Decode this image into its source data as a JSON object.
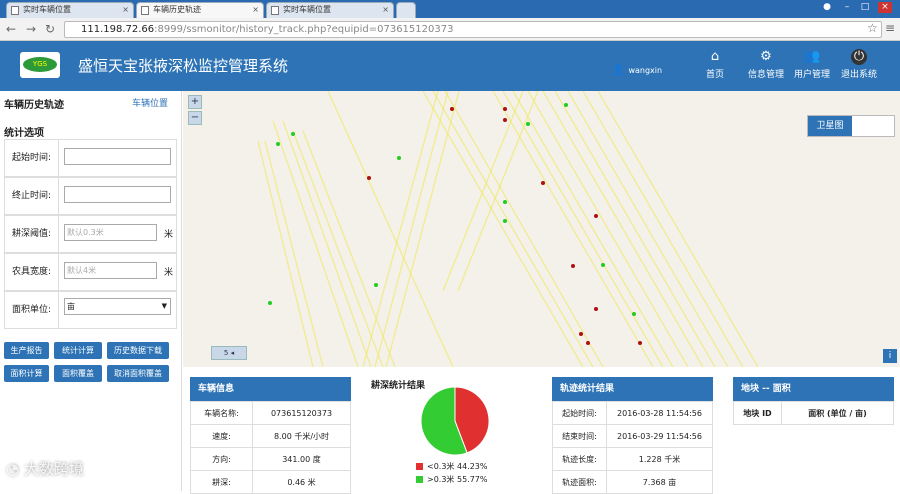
{
  "browser": {
    "tabs": [
      {
        "label": "实时车辆位置",
        "active": false
      },
      {
        "label": "车辆历史轨迹",
        "active": true
      },
      {
        "label": "实时车辆位置",
        "active": false
      }
    ],
    "url_host": "111.198.72.66",
    "url_rest": ":8999/ssmonitor/history_track.php?equipid=073615120373"
  },
  "header": {
    "logo_text": "YGS",
    "title": "盛恒天宝张掖深松监控管理系统",
    "username": "wangxin",
    "nav": [
      {
        "label": "首页",
        "icon": "home-icon"
      },
      {
        "label": "信息管理",
        "icon": "gear-icon"
      },
      {
        "label": "用户管理",
        "icon": "users-icon"
      },
      {
        "label": "退出系统",
        "icon": "power-icon"
      }
    ]
  },
  "sidebar": {
    "title": "车辆历史轨迹",
    "link": "车辆位置",
    "section": "统计选项",
    "fields": [
      {
        "label": "起始时间:",
        "value": "",
        "placeholder": ""
      },
      {
        "label": "终止时间:",
        "value": "",
        "placeholder": ""
      },
      {
        "label": "耕深阈值:",
        "placeholder": "默认0.3米",
        "unit": "米"
      },
      {
        "label": "农具宽度:",
        "placeholder": "默认4米",
        "unit": "米"
      },
      {
        "label": "面积单位:",
        "selected": "亩"
      }
    ],
    "buttons": [
      "生产报告",
      "统计计算",
      "历史数据下载",
      "面积计算",
      "面积覆盖",
      "取消面积覆盖"
    ]
  },
  "map": {
    "zoom_in": "+",
    "zoom_out": "−",
    "scale_label": "5 ◂",
    "toggle_label": "卫星图",
    "info": "i",
    "track_color": "#f0e86a",
    "red_point_color": "#b01010",
    "green_point_color": "#22cc22"
  },
  "vehicle_info": {
    "title": "车辆信息",
    "rows": [
      {
        "label": "车辆名称:",
        "value": "073615120373"
      },
      {
        "label": "速度:",
        "value": "8.00 千米/小时"
      },
      {
        "label": "方向:",
        "value": "341.00 度"
      },
      {
        "label": "耕深:",
        "value": "0.46 米"
      }
    ]
  },
  "depth_stats": {
    "title": "耕深统计结果",
    "legend": [
      {
        "label": "<0.3米",
        "percent": "44.23%",
        "color": "#e03030"
      },
      {
        "label": ">0.3米",
        "percent": "55.77%",
        "color": "#33cc33"
      }
    ]
  },
  "chart_data": {
    "type": "pie",
    "categories": [
      "<0.3米",
      ">0.3米"
    ],
    "values": [
      44.23,
      55.77
    ],
    "colors": [
      "#e03030",
      "#33cc33"
    ],
    "title": "耕深统计结果"
  },
  "track_stats": {
    "title": "轨迹统计结果",
    "rows": [
      {
        "label": "起始时间:",
        "value": "2016-03-28 11:54:56"
      },
      {
        "label": "结束时间:",
        "value": "2016-03-29 11:54:56"
      },
      {
        "label": "轨迹长度:",
        "value": "1.228 千米"
      },
      {
        "label": "轨迹面积:",
        "value": "7.368 亩"
      }
    ]
  },
  "parcel": {
    "title": "地块 -- 面积",
    "col1": "地块 ID",
    "col2": "面积 (单位 / 亩)"
  },
  "watermark": "大数跨境"
}
